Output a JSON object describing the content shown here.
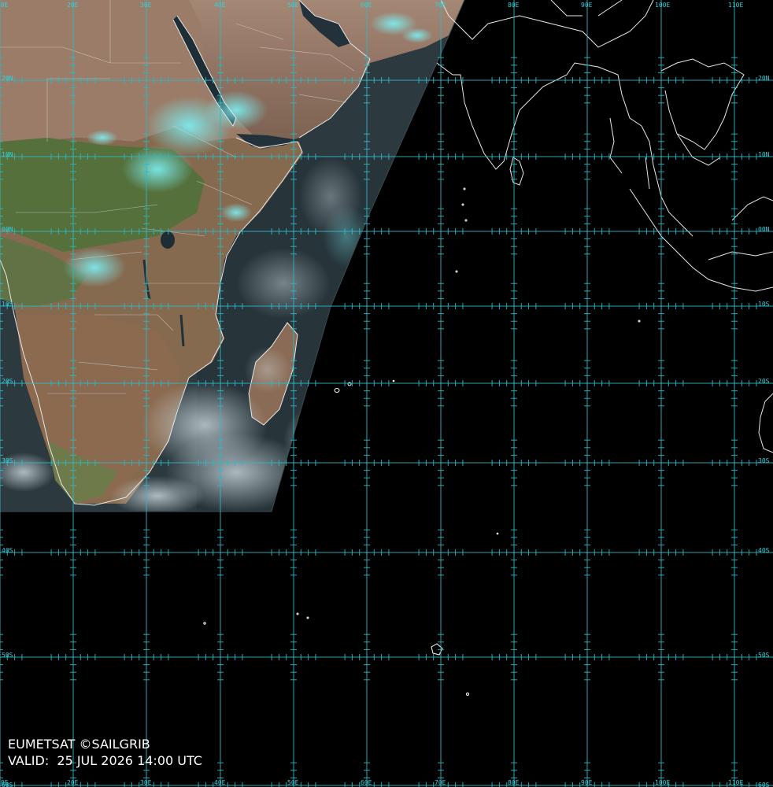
{
  "map": {
    "credit_line": "EUMETSAT ©SAILGRIB",
    "valid_line": "VALID:  25 JUL 2026 14:00 UTC",
    "longitudes": [
      "10E",
      "20E",
      "30E",
      "40E",
      "50E",
      "60E",
      "70E",
      "80E",
      "90E",
      "100E",
      "110E"
    ],
    "latitudes": [
      "20N",
      "10N",
      "00N",
      "10S",
      "20S",
      "30S",
      "40S",
      "50S",
      "60S"
    ],
    "colors": {
      "grid": "#2fb8c4",
      "labels": "#37d0da",
      "coastline": "#e8e8e8",
      "land": "#8a6a52",
      "vegetation": "#4e6a34",
      "ocean": "#2a3438",
      "cloud": "#6fe3ea"
    }
  }
}
